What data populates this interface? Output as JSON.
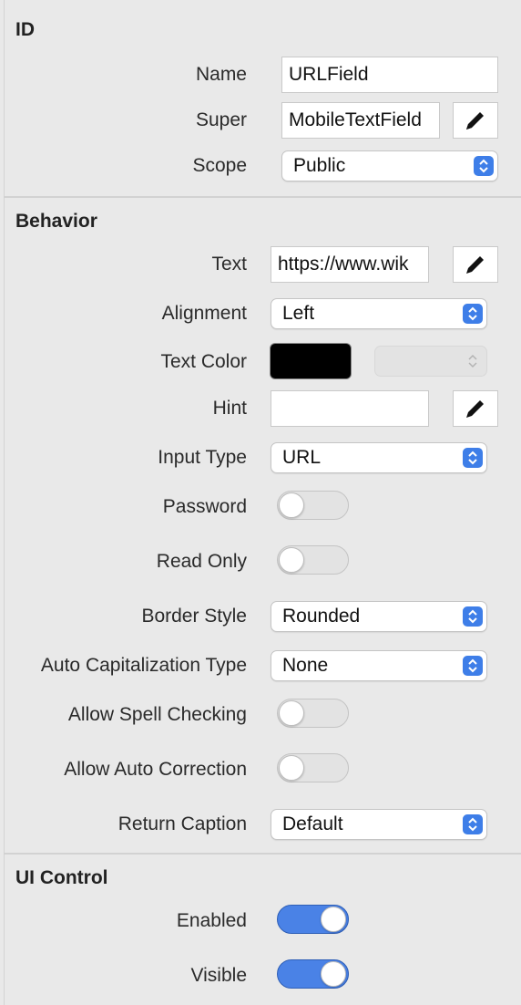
{
  "id_section": {
    "title": "ID",
    "name_label": "Name",
    "name_value": "URLField",
    "super_label": "Super",
    "super_value": "MobileTextField",
    "scope_label": "Scope",
    "scope_value": "Public"
  },
  "behavior": {
    "title": "Behavior",
    "text_label": "Text",
    "text_value": "https://www.wik",
    "alignment_label": "Alignment",
    "alignment_value": "Left",
    "text_color_label": "Text Color",
    "text_color_value": "#000000",
    "hint_label": "Hint",
    "hint_value": "",
    "input_type_label": "Input Type",
    "input_type_value": "URL",
    "password_label": "Password",
    "password_on": false,
    "read_only_label": "Read Only",
    "read_only_on": false,
    "border_style_label": "Border Style",
    "border_style_value": "Rounded",
    "auto_cap_label": "Auto Capitalization Type",
    "auto_cap_value": "None",
    "spell_label": "Allow Spell Checking",
    "spell_on": false,
    "autocorrect_label": "Allow Auto Correction",
    "autocorrect_on": false,
    "return_caption_label": "Return Caption",
    "return_caption_value": "Default"
  },
  "ui_control": {
    "title": "UI Control",
    "enabled_label": "Enabled",
    "enabled_on": true,
    "visible_label": "Visible",
    "visible_on": true
  },
  "colors": {
    "accent": "#3e7ee8",
    "toggle_on": "#4a82e6",
    "background": "#e9e9e9"
  },
  "icons": {
    "edit": "pencil-icon",
    "popup": "up-down-chevron-icon"
  }
}
